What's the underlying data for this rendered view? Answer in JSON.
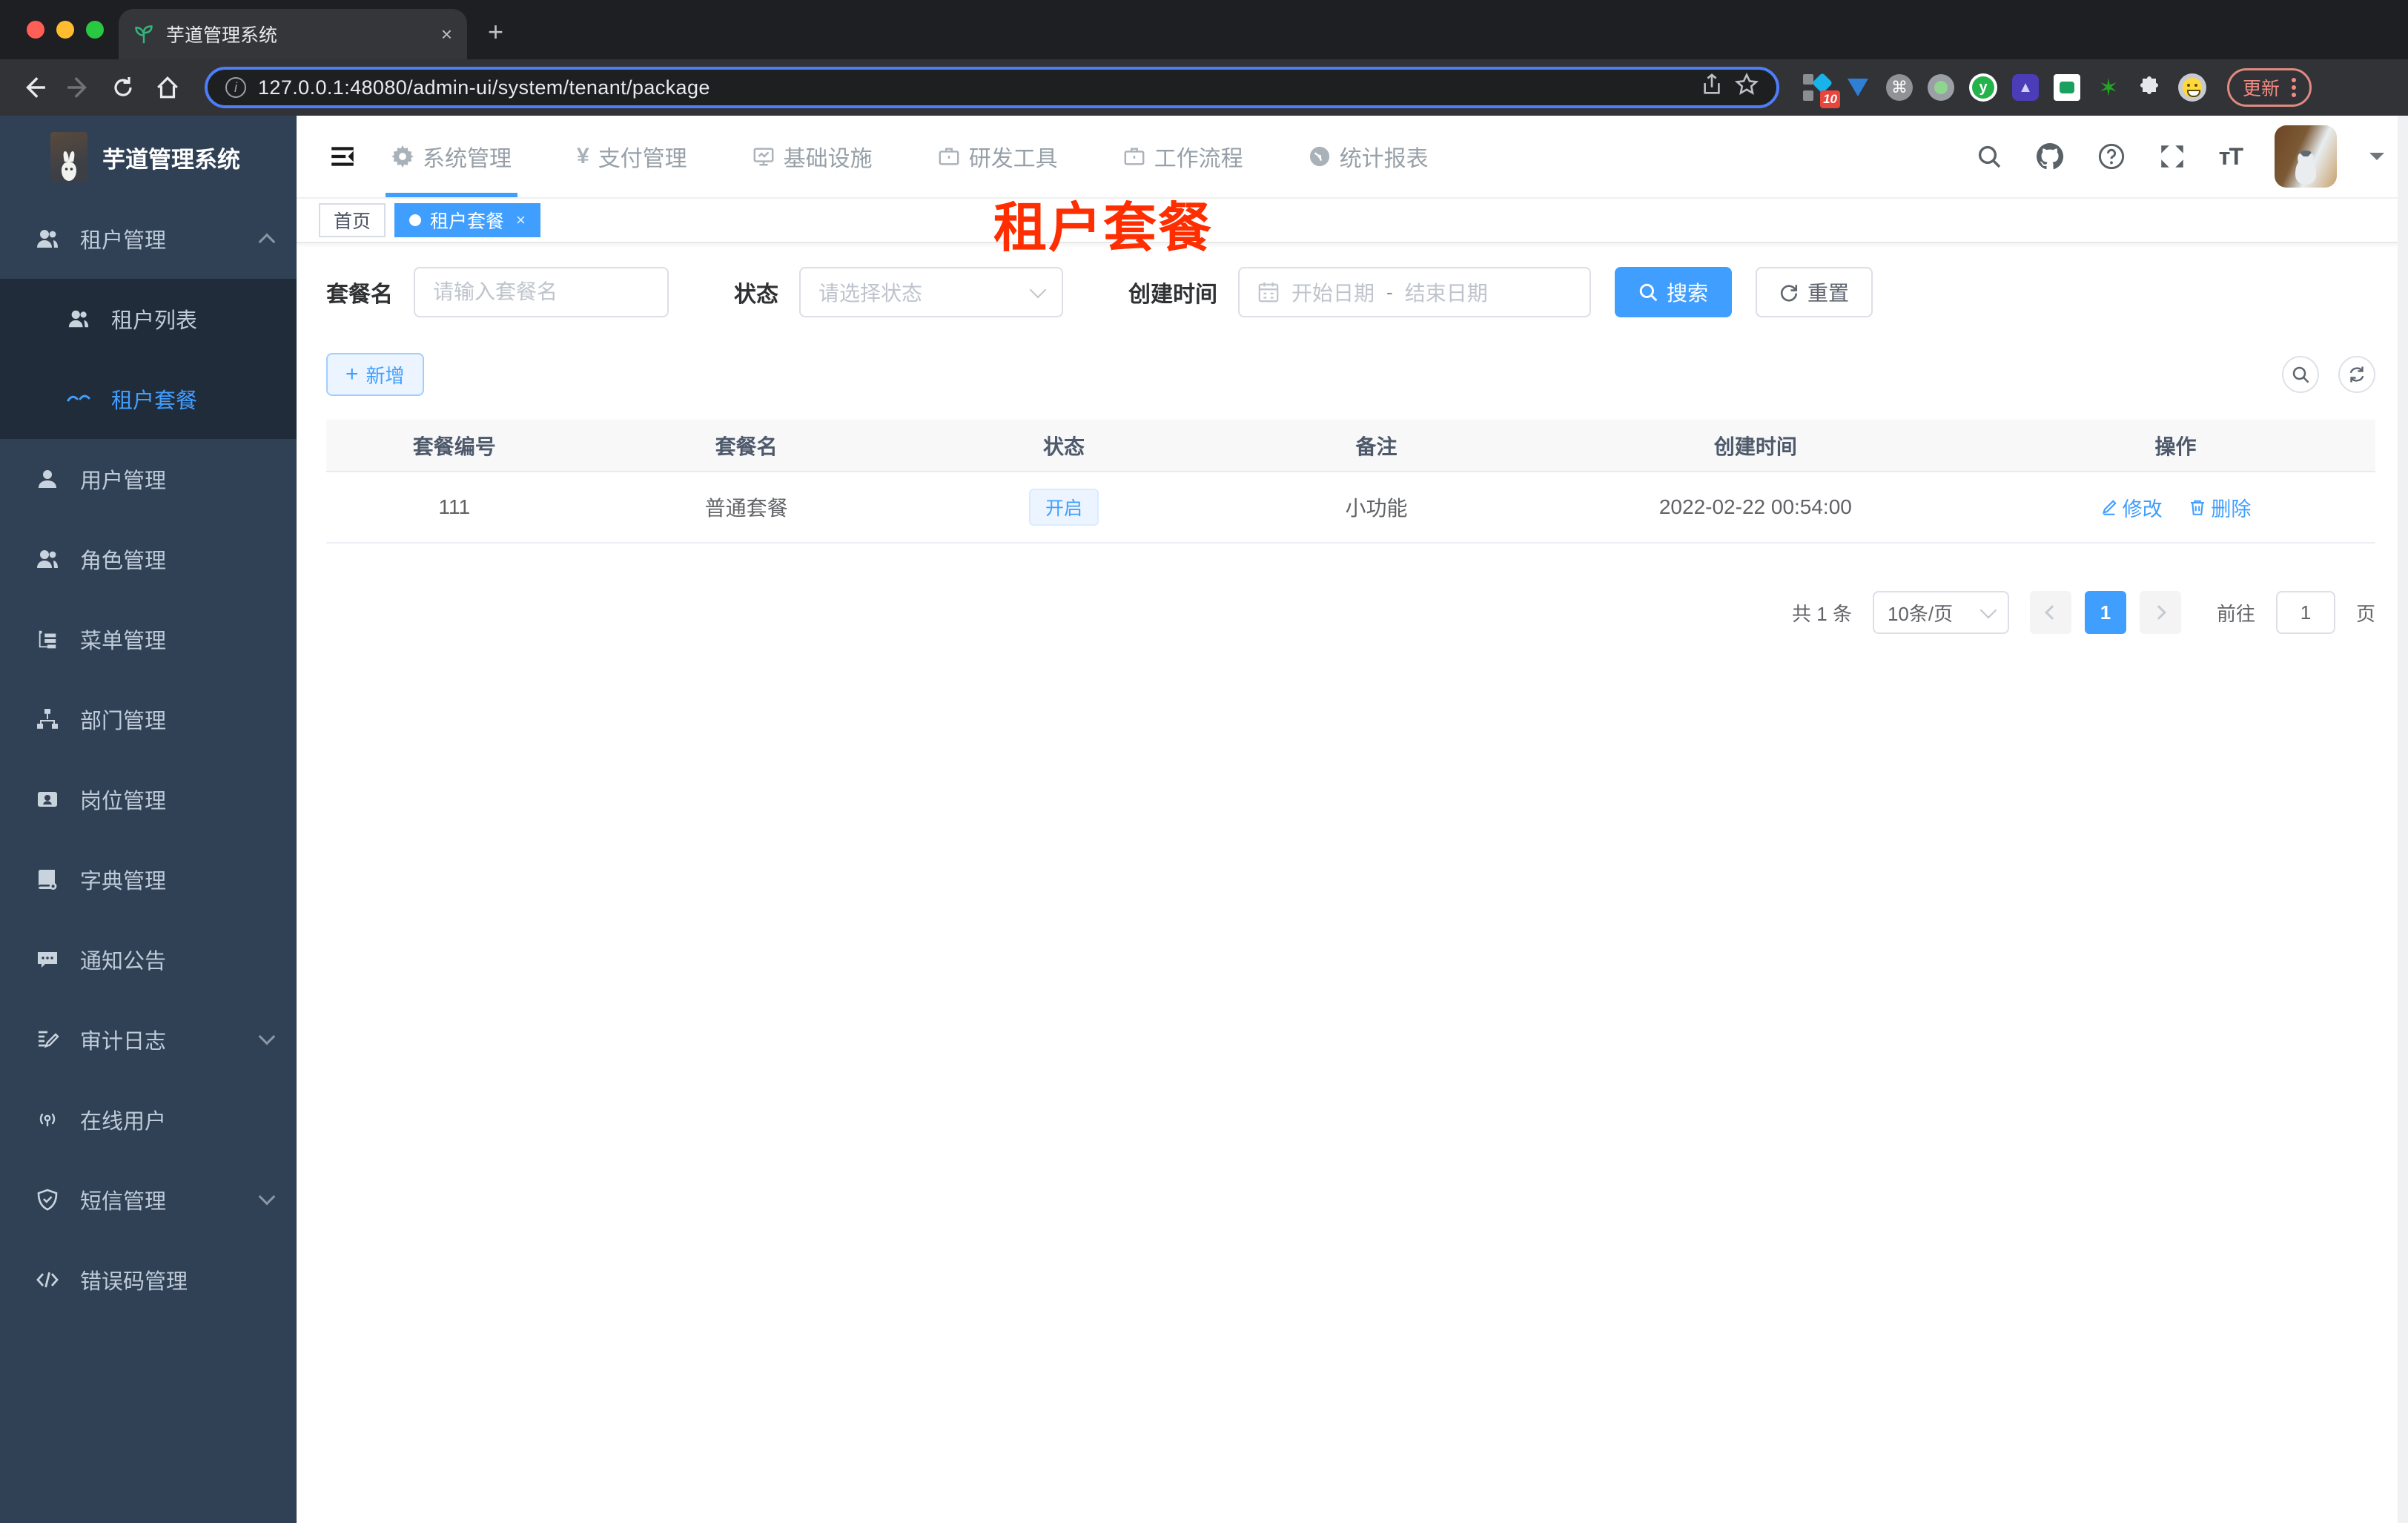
{
  "colors": {
    "accent": "#409eff",
    "overlay_red": "#fe2e00",
    "sidebar_bg": "#304156",
    "submenu_bg": "#212c3b",
    "traffic_lights": [
      "#ff5f57",
      "#febc2e",
      "#28c840"
    ]
  },
  "browser": {
    "tab_title": "芋道管理系统",
    "tab_close": "×",
    "new_tab": "+",
    "url": "127.0.0.1:48080/admin-ui/system/tenant/package",
    "extension_badge": "10",
    "update_label": "更新",
    "extension_icons": [
      "blocker-icon",
      "gem-icon",
      "command-icon",
      "recorder-icon",
      "y-circle-icon",
      "shield-ext-icon",
      "chat-ext-icon",
      "star-ext-icon",
      "puzzle-icon",
      "emoji-ext-icon"
    ]
  },
  "sidebar": {
    "logo_title": "芋道管理系统",
    "items": [
      {
        "label": "租户管理",
        "icon": "users-icon",
        "arrow": "up",
        "level": "top"
      },
      {
        "label": "租户列表",
        "icon": "users-icon",
        "level": "sub"
      },
      {
        "label": "租户套餐",
        "icon": "package-icon",
        "level": "sub",
        "active": true
      },
      {
        "label": "用户管理",
        "icon": "user-icon",
        "level": "top"
      },
      {
        "label": "角色管理",
        "icon": "users-icon",
        "level": "top"
      },
      {
        "label": "菜单管理",
        "icon": "menu-tree-icon",
        "level": "top"
      },
      {
        "label": "部门管理",
        "icon": "sitemap-icon",
        "level": "top"
      },
      {
        "label": "岗位管理",
        "icon": "badge-icon",
        "level": "top"
      },
      {
        "label": "字典管理",
        "icon": "dictionary-icon",
        "level": "top"
      },
      {
        "label": "通知公告",
        "icon": "message-icon",
        "level": "top"
      },
      {
        "label": "审计日志",
        "icon": "log-icon",
        "arrow": "down",
        "level": "top"
      },
      {
        "label": "在线用户",
        "icon": "online-icon",
        "level": "top"
      },
      {
        "label": "短信管理",
        "icon": "shield-icon",
        "arrow": "down",
        "level": "top"
      },
      {
        "label": "错误码管理",
        "icon": "code-icon",
        "level": "top"
      }
    ]
  },
  "header": {
    "nav": [
      {
        "label": "系统管理",
        "icon": "gear-icon",
        "active": true
      },
      {
        "label": "支付管理",
        "icon": "yen-icon"
      },
      {
        "label": "基础设施",
        "icon": "monitor-icon"
      },
      {
        "label": "研发工具",
        "icon": "briefcase-icon"
      },
      {
        "label": "工作流程",
        "icon": "briefcase-icon"
      },
      {
        "label": "统计报表",
        "icon": "gauge-icon"
      }
    ],
    "font_icon_label": "тT"
  },
  "tags": {
    "home": "首页",
    "active": "租户套餐",
    "close": "×"
  },
  "overlay": {
    "title": "租户套餐"
  },
  "filters": {
    "name_label": "套餐名",
    "name_placeholder": "请输入套餐名",
    "status_label": "状态",
    "status_placeholder": "请选择状态",
    "time_label": "创建时间",
    "start_placeholder": "开始日期",
    "range_separator": "-",
    "end_placeholder": "结束日期",
    "search_label": "搜索",
    "reset_label": "重置"
  },
  "toolbar": {
    "add_label": "新增"
  },
  "table": {
    "columns": [
      "套餐编号",
      "套餐名",
      "状态",
      "备注",
      "创建时间",
      "操作"
    ],
    "rows": [
      {
        "id": "111",
        "name": "普通套餐",
        "status": "开启",
        "remark": "小功能",
        "create_time": "2022-02-22 00:54:00",
        "edit_label": "修改",
        "delete_label": "删除"
      }
    ]
  },
  "pagination": {
    "total_text": "共 1 条",
    "page_size": "10条/页",
    "current_page": "1",
    "goto_label": "前往",
    "goto_value": "1",
    "page_suffix": "页"
  }
}
